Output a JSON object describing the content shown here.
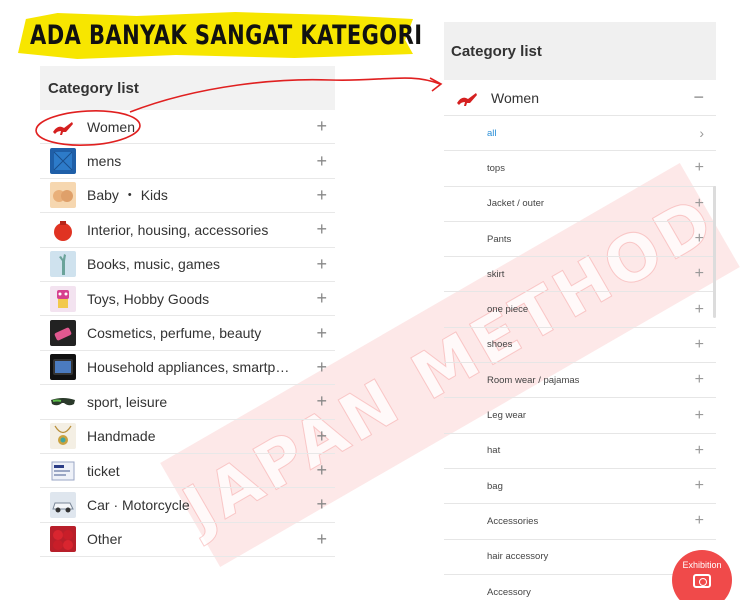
{
  "banner": {
    "text": "ADA BANYAK SANGAT KATEGORI",
    "color": "#f7e600"
  },
  "watermark": {
    "text": "JAPAN METHOD"
  },
  "left_panel": {
    "title": "Category list",
    "items": [
      {
        "label": "Women",
        "icon": "red-heels-icon"
      },
      {
        "label": "mens",
        "icon": "blue-shirt-icon"
      },
      {
        "label": "Baby ・ Kids",
        "icon": "baby-hands-icon"
      },
      {
        "label": "Interior, housing, accessories",
        "icon": "red-teapot-icon"
      },
      {
        "label": "Books, music, games",
        "icon": "statue-of-liberty-icon"
      },
      {
        "label": "Toys, Hobby Goods",
        "icon": "toy-robot-icon"
      },
      {
        "label": "Cosmetics, perfume, beauty",
        "icon": "cosmetics-icon"
      },
      {
        "label": "Household appliances, smartph…",
        "icon": "tablet-icon"
      },
      {
        "label": "sport, leisure",
        "icon": "sunglasses-icon"
      },
      {
        "label": "Handmade",
        "icon": "pendant-necklace-icon"
      },
      {
        "label": "ticket",
        "icon": "ticket-icon"
      },
      {
        "label": "Car · Motorcycle",
        "icon": "car-icon"
      },
      {
        "label": "Other",
        "icon": "strawberries-icon"
      }
    ]
  },
  "right_panel": {
    "title": "Category list",
    "expanded_item": {
      "label": "Women",
      "icon": "red-heels-icon"
    },
    "subitems": [
      {
        "label": "all"
      },
      {
        "label": "tops"
      },
      {
        "label": "Jacket / outer"
      },
      {
        "label": "Pants"
      },
      {
        "label": "skirt"
      },
      {
        "label": "one piece"
      },
      {
        "label": "shoes"
      },
      {
        "label": "Room wear / pajamas"
      },
      {
        "label": "Leg wear"
      },
      {
        "label": "hat"
      },
      {
        "label": "bag"
      },
      {
        "label": "Accessories"
      },
      {
        "label": "hair accessory"
      },
      {
        "label": "Accessory"
      }
    ],
    "exhibit_button": {
      "label": "Exhibition"
    }
  },
  "colors": {
    "accent_red": "#f04a4a",
    "link_blue": "#2a8fd8",
    "header_bg": "#f2f2f2"
  }
}
